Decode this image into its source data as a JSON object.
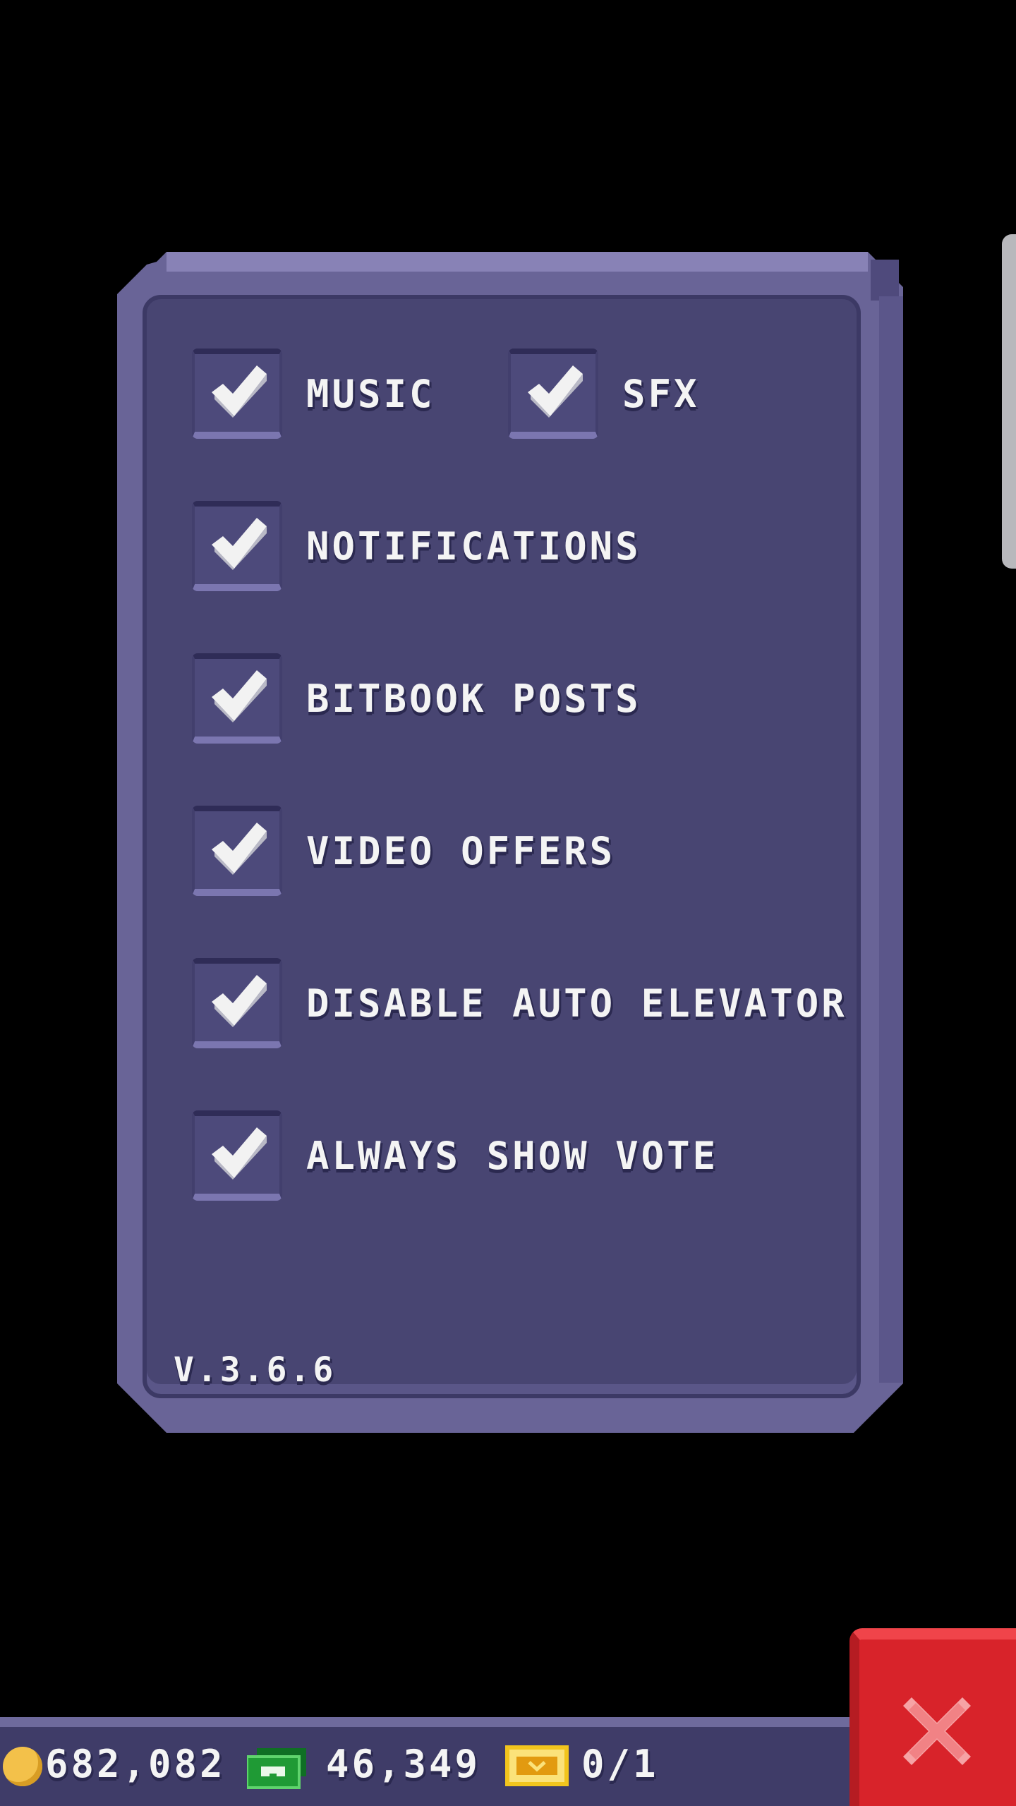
{
  "settings": {
    "options": [
      {
        "id": "music",
        "label": "MUSIC",
        "checked": true
      },
      {
        "id": "sfx",
        "label": "SFX",
        "checked": true
      },
      {
        "id": "notifications",
        "label": "NOTIFICATIONS",
        "checked": true
      },
      {
        "id": "bitbook_posts",
        "label": "BITBOOK POSTS",
        "checked": true
      },
      {
        "id": "video_offers",
        "label": "VIDEO OFFERS",
        "checked": true
      },
      {
        "id": "disable_auto_elevator",
        "label": "DISABLE AUTO ELEVATOR",
        "checked": true
      },
      {
        "id": "always_show_vote",
        "label": "ALWAYS SHOW VOTE",
        "checked": true
      }
    ],
    "version": "V.3.6.6"
  },
  "currency": {
    "coins": "682,082",
    "bux": "46,349",
    "tickets": "0/1"
  },
  "colors": {
    "panel": "#696497",
    "panel_inner": "#484572",
    "close_button": "#d8232a",
    "coin": "#f3c14a",
    "bux": "#1f9a35",
    "ticket": "#f2c51d"
  },
  "icons": {
    "check": "checkmark-icon",
    "close": "close-x-icon",
    "coin": "coin-icon",
    "bux": "bux-icon",
    "ticket": "ticket-icon"
  }
}
